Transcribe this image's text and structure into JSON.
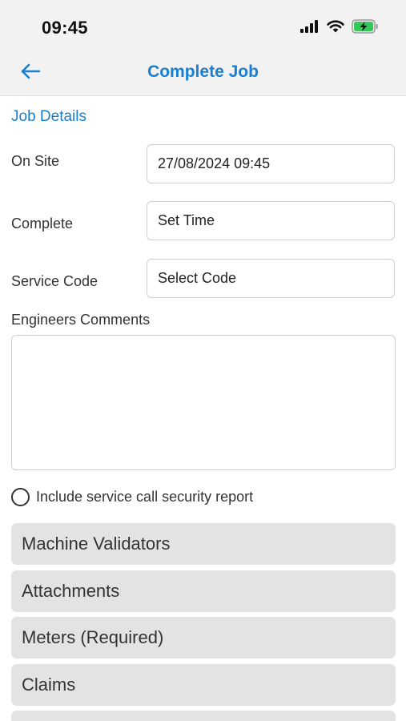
{
  "status_bar": {
    "time": "09:45",
    "icons": [
      "signal-icon",
      "wifi-icon",
      "battery-charging-icon"
    ],
    "battery_color": "#34c759"
  },
  "navbar": {
    "title": "Complete Job",
    "back_icon": "arrow-left-icon",
    "accent_color": "#1a7fd0"
  },
  "job_details": {
    "section_label": "Job Details",
    "on_site": {
      "label": "On Site",
      "value": "27/08/2024 09:45"
    },
    "complete": {
      "label": "Complete",
      "placeholder": "Set Time"
    },
    "service_code": {
      "label": "Service Code",
      "placeholder": "Select Code"
    },
    "comments": {
      "label": "Engineers Comments",
      "value": ""
    },
    "security_report": {
      "label": "Include service call security report",
      "checked": false
    }
  },
  "sections": [
    {
      "label": "Machine Validators"
    },
    {
      "label": "Attachments"
    },
    {
      "label": "Meters (Required)"
    },
    {
      "label": "Claims"
    },
    {
      "label": ""
    }
  ]
}
